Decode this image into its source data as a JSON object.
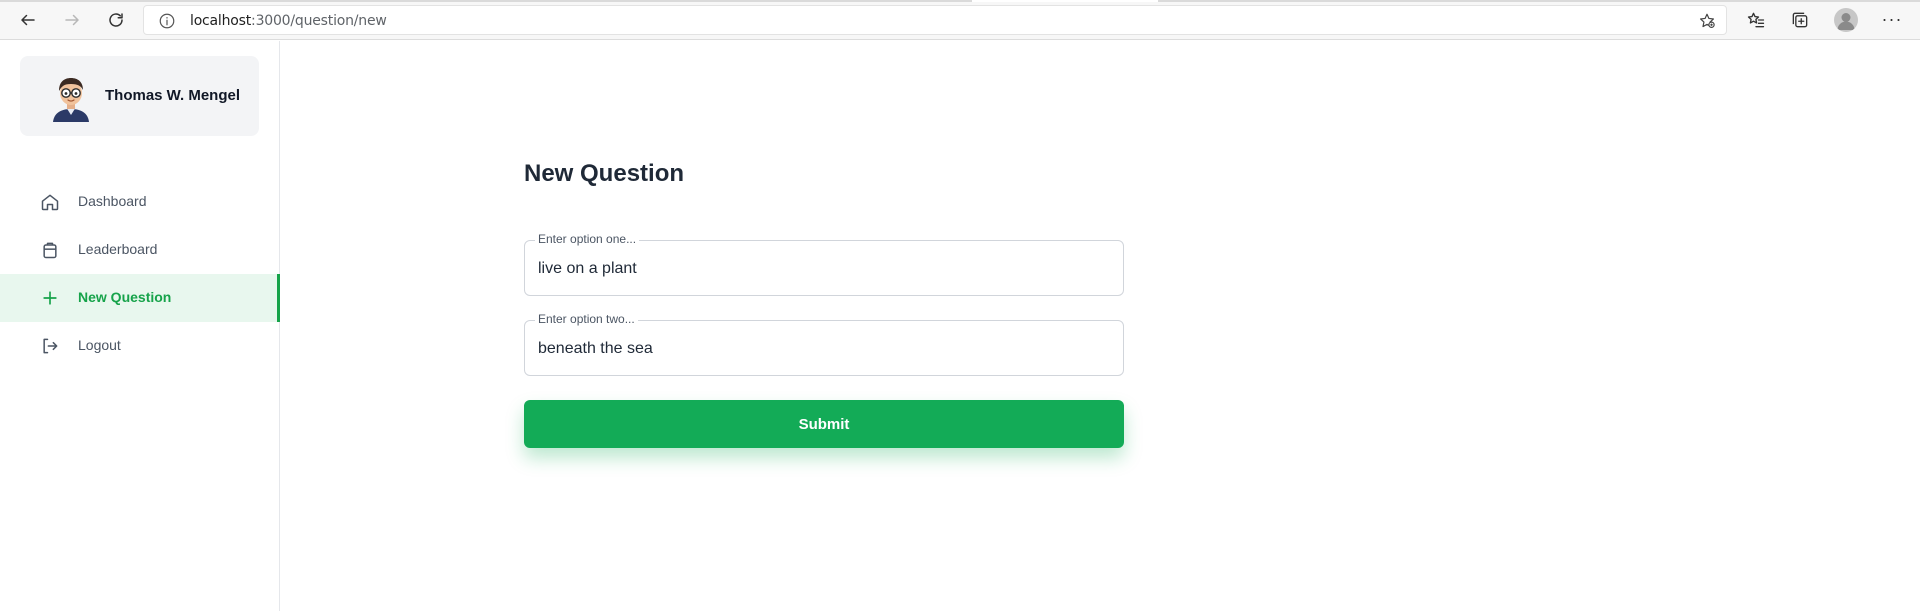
{
  "browser": {
    "url_host": "localhost",
    "url_rest": ":3000/question/new"
  },
  "user": {
    "name": "Thomas W. Mengel"
  },
  "menu": {
    "items": [
      {
        "label": "Dashboard",
        "icon": "home-icon",
        "active": false
      },
      {
        "label": "Leaderboard",
        "icon": "clipboard-icon",
        "active": false
      },
      {
        "label": "New Question",
        "icon": "plus-icon",
        "active": true
      },
      {
        "label": "Logout",
        "icon": "logout-icon",
        "active": false
      }
    ]
  },
  "form": {
    "title": "New Question",
    "option_one": {
      "label": "Enter option one...",
      "value": "live on a plant"
    },
    "option_two": {
      "label": "Enter option two...",
      "value": "beneath the sea"
    },
    "submit_label": "Submit"
  },
  "colors": {
    "accent": "#13ab57",
    "active_bg": "#e8f7ee",
    "card_bg": "#f3f4f6"
  }
}
